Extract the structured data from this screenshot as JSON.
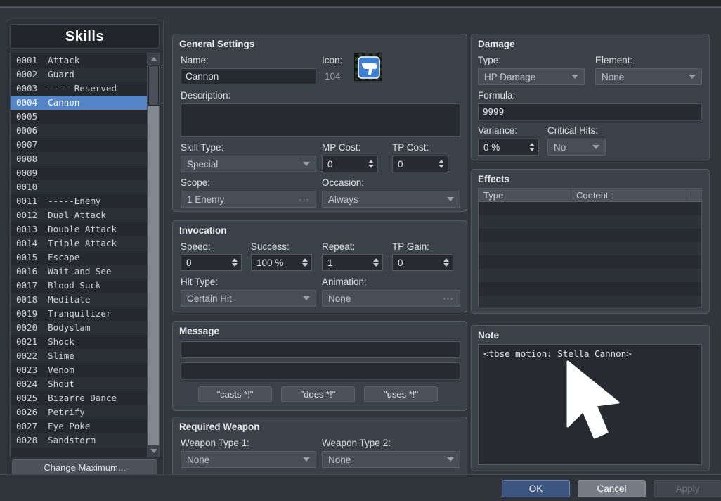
{
  "window": {
    "title": "Skills"
  },
  "sidebar": {
    "title": "Skills",
    "change_max_label": "Change Maximum...",
    "selected_index": 3,
    "items": [
      {
        "id": "0001",
        "name": "Attack"
      },
      {
        "id": "0002",
        "name": "Guard"
      },
      {
        "id": "0003",
        "name": "-----Reserved"
      },
      {
        "id": "0004",
        "name": "Cannon"
      },
      {
        "id": "0005",
        "name": ""
      },
      {
        "id": "0006",
        "name": ""
      },
      {
        "id": "0007",
        "name": ""
      },
      {
        "id": "0008",
        "name": ""
      },
      {
        "id": "0009",
        "name": ""
      },
      {
        "id": "0010",
        "name": ""
      },
      {
        "id": "0011",
        "name": "-----Enemy"
      },
      {
        "id": "0012",
        "name": "Dual Attack"
      },
      {
        "id": "0013",
        "name": "Double Attack"
      },
      {
        "id": "0014",
        "name": "Triple Attack"
      },
      {
        "id": "0015",
        "name": "Escape"
      },
      {
        "id": "0016",
        "name": "Wait and See"
      },
      {
        "id": "0017",
        "name": "Blood Suck"
      },
      {
        "id": "0018",
        "name": "Meditate"
      },
      {
        "id": "0019",
        "name": "Tranquilizer"
      },
      {
        "id": "0020",
        "name": "Bodyslam"
      },
      {
        "id": "0021",
        "name": "Shock"
      },
      {
        "id": "0022",
        "name": "Slime"
      },
      {
        "id": "0023",
        "name": "Venom"
      },
      {
        "id": "0024",
        "name": "Shout"
      },
      {
        "id": "0025",
        "name": "Bizarre Dance"
      },
      {
        "id": "0026",
        "name": "Petrify"
      },
      {
        "id": "0027",
        "name": "Eye Poke"
      },
      {
        "id": "0028",
        "name": "Sandstorm"
      }
    ]
  },
  "general": {
    "group_title": "General Settings",
    "name_label": "Name:",
    "name_value": "Cannon",
    "icon_label": "Icon:",
    "icon_index": "104",
    "icon_name": "pistol-icon",
    "description_label": "Description:",
    "description_value": "",
    "skill_type_label": "Skill Type:",
    "skill_type_value": "Special",
    "mp_cost_label": "MP Cost:",
    "mp_cost_value": "0",
    "tp_cost_label": "TP Cost:",
    "tp_cost_value": "0",
    "scope_label": "Scope:",
    "scope_value": "1 Enemy",
    "occasion_label": "Occasion:",
    "occasion_value": "Always"
  },
  "invocation": {
    "group_title": "Invocation",
    "speed_label": "Speed:",
    "speed_value": "0",
    "success_label": "Success:",
    "success_value": "100 %",
    "repeat_label": "Repeat:",
    "repeat_value": "1",
    "tp_gain_label": "TP Gain:",
    "tp_gain_value": "0",
    "hit_type_label": "Hit Type:",
    "hit_type_value": "Certain Hit",
    "animation_label": "Animation:",
    "animation_value": "None"
  },
  "message": {
    "group_title": "Message",
    "line1_value": "",
    "line2_value": "",
    "buttons": [
      "\"casts *!\"",
      "\"does *!\"",
      "\"uses *!\""
    ]
  },
  "required_weapon": {
    "group_title": "Required Weapon",
    "weapon1_label": "Weapon Type 1:",
    "weapon1_value": "None",
    "weapon2_label": "Weapon Type 2:",
    "weapon2_value": "None"
  },
  "damage": {
    "group_title": "Damage",
    "type_label": "Type:",
    "type_value": "HP Damage",
    "element_label": "Element:",
    "element_value": "None",
    "formula_label": "Formula:",
    "formula_value": "9999",
    "variance_label": "Variance:",
    "variance_value": "0 %",
    "critical_label": "Critical Hits:",
    "critical_value": "No"
  },
  "effects": {
    "group_title": "Effects",
    "columns": [
      "Type",
      "Content",
      ""
    ],
    "rows": []
  },
  "note": {
    "group_title": "Note",
    "value": "<tbse motion: Stella Cannon>"
  },
  "footer": {
    "ok_label": "OK",
    "cancel_label": "Cancel",
    "apply_label": "Apply"
  },
  "colors": {
    "accent_selection": "#5684c8",
    "dialog_bg": "#32373e",
    "group_bg": "#3b4149",
    "input_bg": "#272b31",
    "primary_button": "#3c5580"
  }
}
